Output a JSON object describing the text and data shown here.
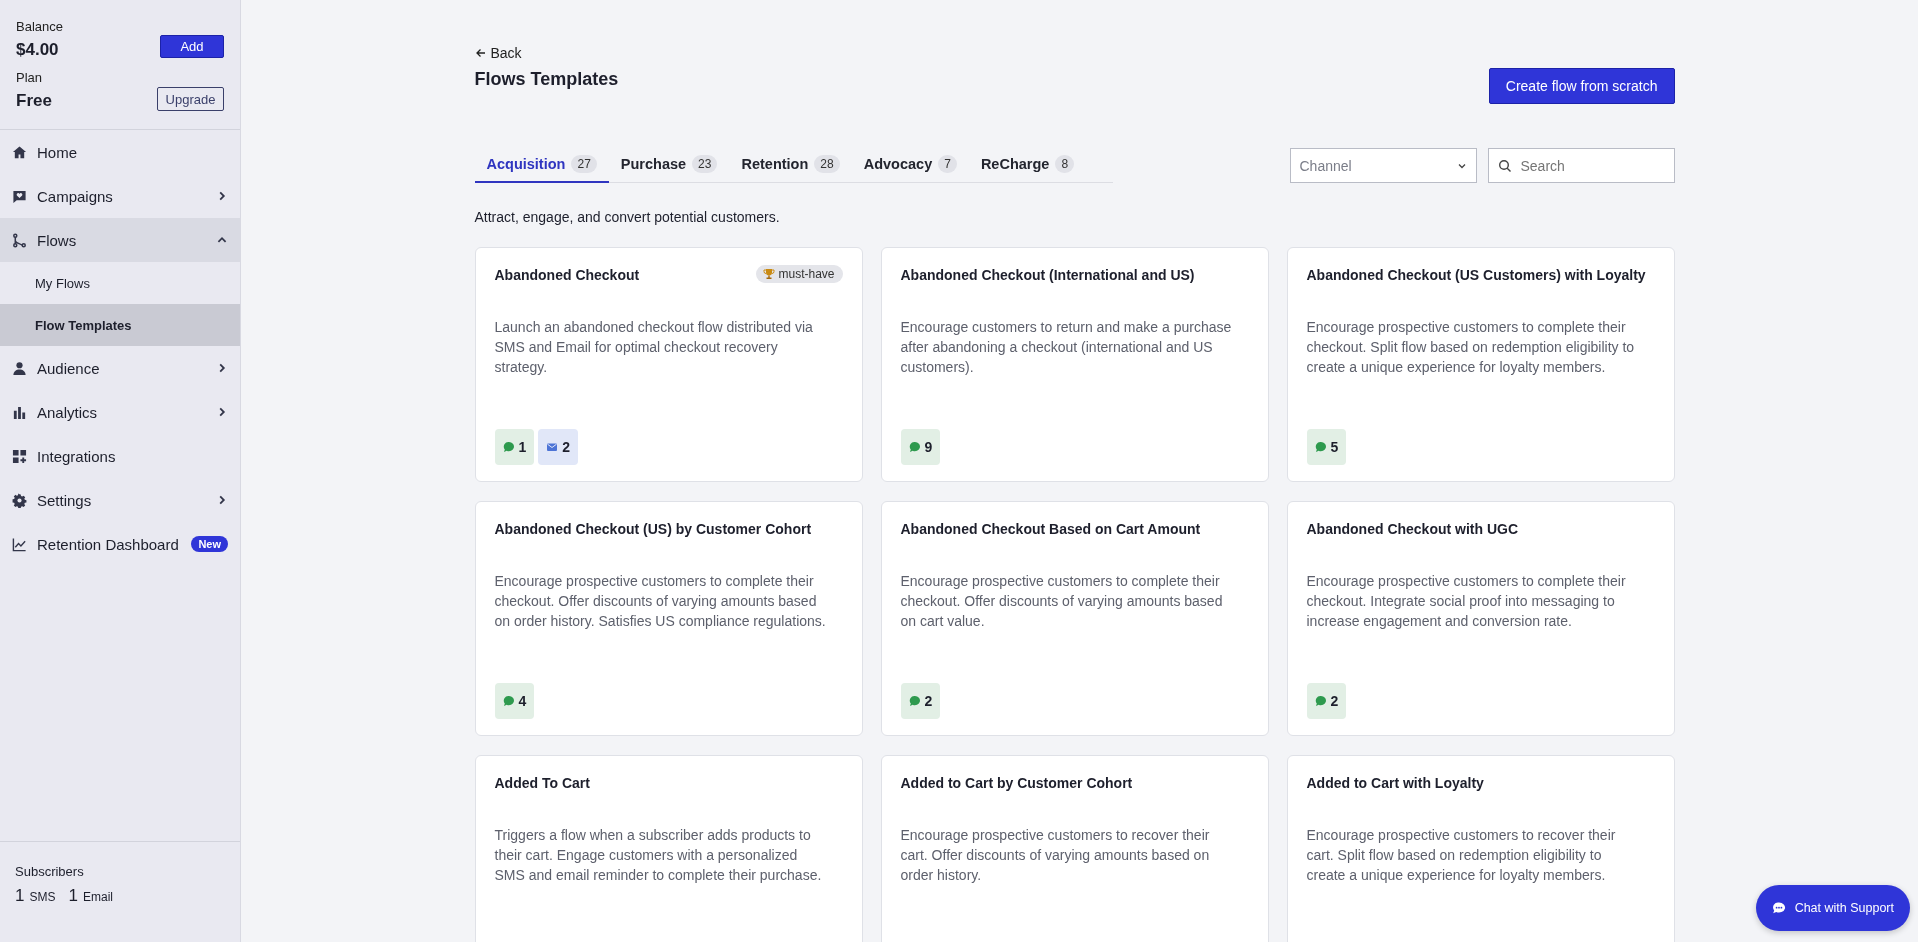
{
  "sidebar": {
    "balance": {
      "label": "Balance",
      "value": "$4.00",
      "button": "Add"
    },
    "plan": {
      "label": "Plan",
      "value": "Free",
      "button": "Upgrade"
    },
    "items": [
      {
        "label": "Home",
        "expandable": false,
        "active": false
      },
      {
        "label": "Campaigns",
        "expandable": true,
        "expanded": false,
        "active": false
      },
      {
        "label": "Flows",
        "expandable": true,
        "expanded": true,
        "active": true,
        "children": [
          {
            "label": "My Flows",
            "selected": false
          },
          {
            "label": "Flow Templates",
            "selected": true
          }
        ]
      },
      {
        "label": "Audience",
        "expandable": true,
        "expanded": false,
        "active": false
      },
      {
        "label": "Analytics",
        "expandable": true,
        "expanded": false,
        "active": false
      },
      {
        "label": "Integrations",
        "expandable": false,
        "active": false
      },
      {
        "label": "Settings",
        "expandable": true,
        "expanded": false,
        "active": false
      },
      {
        "label": "Retention Dashboard",
        "expandable": false,
        "active": false,
        "badge": "New"
      }
    ],
    "subscribers": {
      "label": "Subscribers",
      "counts": [
        {
          "value": "1",
          "unit": "SMS"
        },
        {
          "value": "1",
          "unit": "Email"
        }
      ]
    }
  },
  "header": {
    "back": "Back",
    "title": "Flows Templates",
    "create_button": "Create flow from scratch"
  },
  "tabs": [
    {
      "label": "Acquisition",
      "count": "27",
      "selected": true
    },
    {
      "label": "Purchase",
      "count": "23",
      "selected": false
    },
    {
      "label": "Retention",
      "count": "28",
      "selected": false
    },
    {
      "label": "Advocacy",
      "count": "7",
      "selected": false
    },
    {
      "label": "ReCharge",
      "count": "8",
      "selected": false
    }
  ],
  "channel_select": {
    "placeholder": "Channel"
  },
  "search": {
    "placeholder": "Search"
  },
  "tab_description": "Attract, engage, and convert potential customers.",
  "cards": [
    {
      "title": "Abandoned Checkout",
      "tag": "must-have",
      "description": "Launch an abandoned checkout flow distributed via SMS and Email for optimal checkout recovery strategy.",
      "channels": [
        {
          "kind": "sms",
          "count": "1"
        },
        {
          "kind": "email",
          "count": "2"
        }
      ]
    },
    {
      "title": "Abandoned Checkout (International and US)",
      "description": "Encourage customers to return and make a purchase after abandoning a checkout (international and US customers).",
      "channels": [
        {
          "kind": "sms",
          "count": "9"
        }
      ]
    },
    {
      "title": "Abandoned Checkout (US Customers) with Loyalty",
      "description": "Encourage prospective customers to complete their checkout. Split flow based on redemption eligibility to create a unique experience for loyalty members.",
      "channels": [
        {
          "kind": "sms",
          "count": "5"
        }
      ]
    },
    {
      "title": "Abandoned Checkout (US) by Customer Cohort",
      "description": "Encourage prospective customers to complete their checkout. Offer discounts of varying amounts based on order history. Satisfies US compliance regulations.",
      "channels": [
        {
          "kind": "sms",
          "count": "4"
        }
      ]
    },
    {
      "title": "Abandoned Checkout Based on Cart Amount",
      "description": "Encourage prospective customers to complete their checkout. Offer discounts of varying amounts based on cart value.",
      "channels": [
        {
          "kind": "sms",
          "count": "2"
        }
      ]
    },
    {
      "title": "Abandoned Checkout with UGC",
      "description": "Encourage prospective customers to complete their checkout. Integrate social proof into messaging to increase engagement and conversion rate.",
      "channels": [
        {
          "kind": "sms",
          "count": "2"
        }
      ]
    },
    {
      "title": "Added To Cart",
      "description": "Triggers a flow when a subscriber adds products to their cart. Engage customers with a personalized SMS and email reminder to complete their purchase."
    },
    {
      "title": "Added to Cart by Customer Cohort",
      "description": "Encourage prospective customers to recover their cart. Offer discounts of varying amounts based on order history."
    },
    {
      "title": "Added to Cart with Loyalty",
      "description": "Encourage prospective customers to recover their cart. Split flow based on redemption eligibility to create a unique experience for loyalty members."
    }
  ],
  "chat_button": "Chat with Support"
}
